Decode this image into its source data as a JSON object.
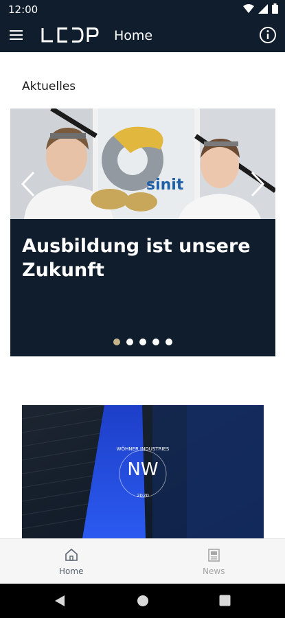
{
  "status_bar": {
    "time": "12:00",
    "icons": [
      "wifi-icon",
      "cellular-icon",
      "battery-icon"
    ]
  },
  "app_bar": {
    "logo_text": "LCDP",
    "title": "Home",
    "menu_icon": "hamburger-menu-icon",
    "info_icon": "info-icon"
  },
  "news": {
    "section_title": "Aktuelles",
    "carousel": {
      "slide_title": "Ausbildung ist unsere Zukunft",
      "image_sign_text": "sinit",
      "slide_count": 5,
      "active_index": 0
    }
  },
  "card": {
    "image_text_top": "WÖHNER INDUSTRIES",
    "image_text_bottom": "2020",
    "monogram": "NW"
  },
  "bottom_nav": {
    "items": [
      {
        "label": "Home",
        "icon": "home-icon",
        "active": true
      },
      {
        "label": "News",
        "icon": "newspaper-icon",
        "active": false
      }
    ]
  },
  "colors": {
    "primary_dark": "#0f1d2c",
    "dot_active": "#c6b48a",
    "accent_blue": "#1f4fd1"
  }
}
